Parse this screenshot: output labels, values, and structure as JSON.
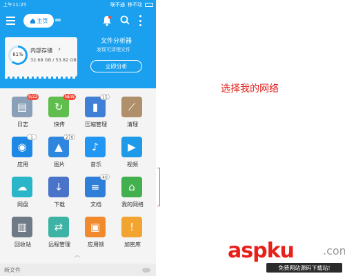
{
  "status": {
    "time": "上午11:25",
    "carrier1": "联不通",
    "carrier2": "移不动"
  },
  "toolbar": {
    "home_label": "主页"
  },
  "storage": {
    "percent_label": "61%",
    "percent": 61,
    "title": "内部存储",
    "size": "32.68 GB / 53.82 GB"
  },
  "analyzer": {
    "title": "文件分析器",
    "subtitle": "发现可清理文件",
    "button": "立即分析"
  },
  "grid": [
    {
      "label": "日志",
      "badge": "9/22",
      "badge_style": "red",
      "color": "#8aa0b8",
      "icon": "log-icon"
    },
    {
      "label": "快传",
      "badge": "NEW",
      "badge_style": "red",
      "color": "#5fbe4d",
      "icon": "transfer-icon"
    },
    {
      "label": "压缩管理",
      "badge": "15",
      "badge_style": "gray",
      "color": "#3f7fd6",
      "icon": "zip-icon"
    },
    {
      "label": "清理",
      "badge": "",
      "badge_style": "",
      "color": "#b0906a",
      "icon": "broom-icon"
    },
    {
      "label": "应用",
      "badge": "1",
      "badge_style": "gray",
      "color": "#1e88e5",
      "icon": "android-icon"
    },
    {
      "label": "图片",
      "badge": "270",
      "badge_style": "gray",
      "color": "#2e86de",
      "icon": "image-icon"
    },
    {
      "label": "音乐",
      "badge": "",
      "badge_style": "",
      "color": "#2196f3",
      "icon": "music-icon"
    },
    {
      "label": "视频",
      "badge": "",
      "badge_style": "",
      "color": "#1e9be8",
      "icon": "video-icon"
    },
    {
      "label": "网盘",
      "badge": "",
      "badge_style": "",
      "color": "#2bb5c9",
      "icon": "cloud-icon"
    },
    {
      "label": "下载",
      "badge": "",
      "badge_style": "",
      "color": "#4a74c9",
      "icon": "download-icon"
    },
    {
      "label": "文档",
      "badge": "40",
      "badge_style": "gray",
      "color": "#2f7fd8",
      "icon": "document-icon"
    },
    {
      "label": "我的网络",
      "badge": "",
      "badge_style": "",
      "color": "#43b04e",
      "icon": "network-icon"
    },
    {
      "label": "回收站",
      "badge": "",
      "badge_style": "",
      "color": "#6e7a86",
      "icon": "trash-icon"
    },
    {
      "label": "远程管理",
      "badge": "",
      "badge_style": "",
      "color": "#3cb3a4",
      "icon": "remote-icon"
    },
    {
      "label": "应用锁",
      "badge": "",
      "badge_style": "",
      "color": "#f08a2c",
      "icon": "lock-icon"
    },
    {
      "label": "加密库",
      "badge": "",
      "badge_style": "",
      "color": "#f2a431",
      "icon": "vault-icon"
    }
  ],
  "footer": {
    "label": "新文件"
  },
  "annotation": {
    "text": "选择我的网络"
  },
  "watermark": {
    "logo": "aspku",
    "dot": ".com",
    "sub": "免费网站源码下载站!"
  }
}
